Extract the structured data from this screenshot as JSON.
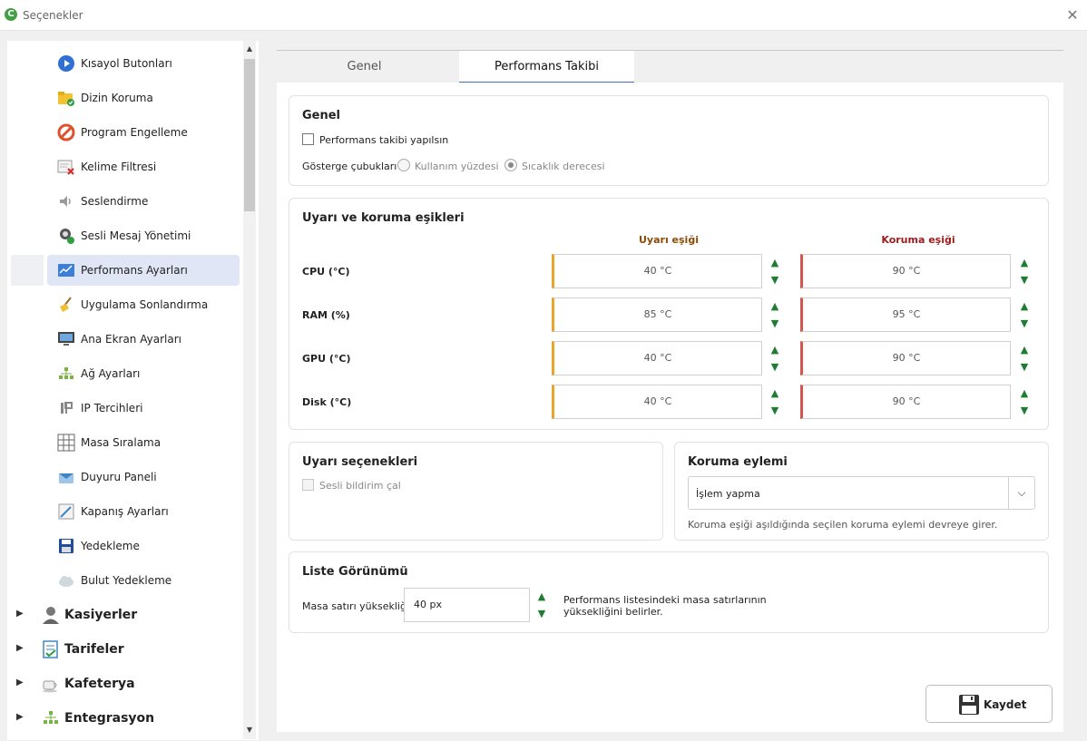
{
  "window": {
    "title": "Seçenekler",
    "close_glyph": "✕"
  },
  "sidebar": {
    "items": [
      {
        "label": "Kısayol Butonları",
        "icon": "play-button-icon"
      },
      {
        "label": "Dizin Koruma",
        "icon": "folder-shield-icon"
      },
      {
        "label": "Program Engelleme",
        "icon": "block-icon"
      },
      {
        "label": "Kelime Filtresi",
        "icon": "word-filter-icon"
      },
      {
        "label": "Seslendirme",
        "icon": "speaker-icon"
      },
      {
        "label": "Sesli Mesaj Yönetimi",
        "icon": "voice-message-icon"
      },
      {
        "label": "Performans Ayarları",
        "icon": "performance-chart-icon"
      },
      {
        "label": "Uygulama Sonlandırma",
        "icon": "broom-icon"
      },
      {
        "label": "Ana Ekran Ayarları",
        "icon": "monitor-icon"
      },
      {
        "label": "Ağ Ayarları",
        "icon": "network-icon"
      },
      {
        "label": "IP Tercihleri",
        "icon": "ip-icon"
      },
      {
        "label": "Masa Sıralama",
        "icon": "grid-icon"
      },
      {
        "label": "Duyuru Paneli",
        "icon": "announcement-icon"
      },
      {
        "label": "Kapanış Ayarları",
        "icon": "shutdown-settings-icon"
      },
      {
        "label": "Yedekleme",
        "icon": "floppy-disk-icon"
      },
      {
        "label": "Bulut Yedekleme",
        "icon": "cloud-backup-icon"
      }
    ],
    "groups": [
      {
        "label": "Kasiyerler",
        "icon": "cashier-icon"
      },
      {
        "label": "Tarifeler",
        "icon": "tariff-icon"
      },
      {
        "label": "Kafeterya",
        "icon": "coffee-icon"
      },
      {
        "label": "Entegrasyon",
        "icon": "integration-icon"
      }
    ]
  },
  "tabs": {
    "general": "Genel",
    "performance": "Performans Takibi"
  },
  "general_panel": {
    "title": "Genel",
    "enable_label": "Performans takibi yapılsın",
    "gauge_label": "Gösterge çubukları",
    "opt_usage": "Kullanım yüzdesi",
    "opt_temp": "Sıcaklık derecesi"
  },
  "thresholds": {
    "title": "Uyarı ve koruma eşikleri",
    "warn_header": "Uyarı eşiği",
    "prot_header": "Koruma eşiği",
    "rows": [
      {
        "label": "CPU (°C)",
        "warn": "40 °C",
        "prot": "90 °C"
      },
      {
        "label": "RAM (%)",
        "warn": "85 °C",
        "prot": "95 °C"
      },
      {
        "label": "GPU (°C)",
        "warn": "40 °C",
        "prot": "90 °C"
      },
      {
        "label": "Disk (°C)",
        "warn": "40 °C",
        "prot": "90 °C"
      }
    ]
  },
  "alert_options": {
    "title": "Uyarı seçenekleri",
    "sound_label": "Sesli bildirim çal"
  },
  "protection": {
    "title": "Koruma eylemi",
    "selected": "İşlem yapma",
    "help": "Koruma eşiği aşıldığında seçilen koruma eylemi devreye girer."
  },
  "list_view": {
    "title": "Liste Görünümü",
    "row_height_label": "Masa satırı yüksekliği",
    "row_height_value": "40 px",
    "help_line1": "Performans listesindeki masa satırlarının",
    "help_line2": "yüksekliğini belirler."
  },
  "save": {
    "label": "Kaydet"
  },
  "colors": {
    "warn": "#8a4b08",
    "prot": "#9b1c1c",
    "accent": "#3d6fc9",
    "stepper": "#1e7d32"
  }
}
